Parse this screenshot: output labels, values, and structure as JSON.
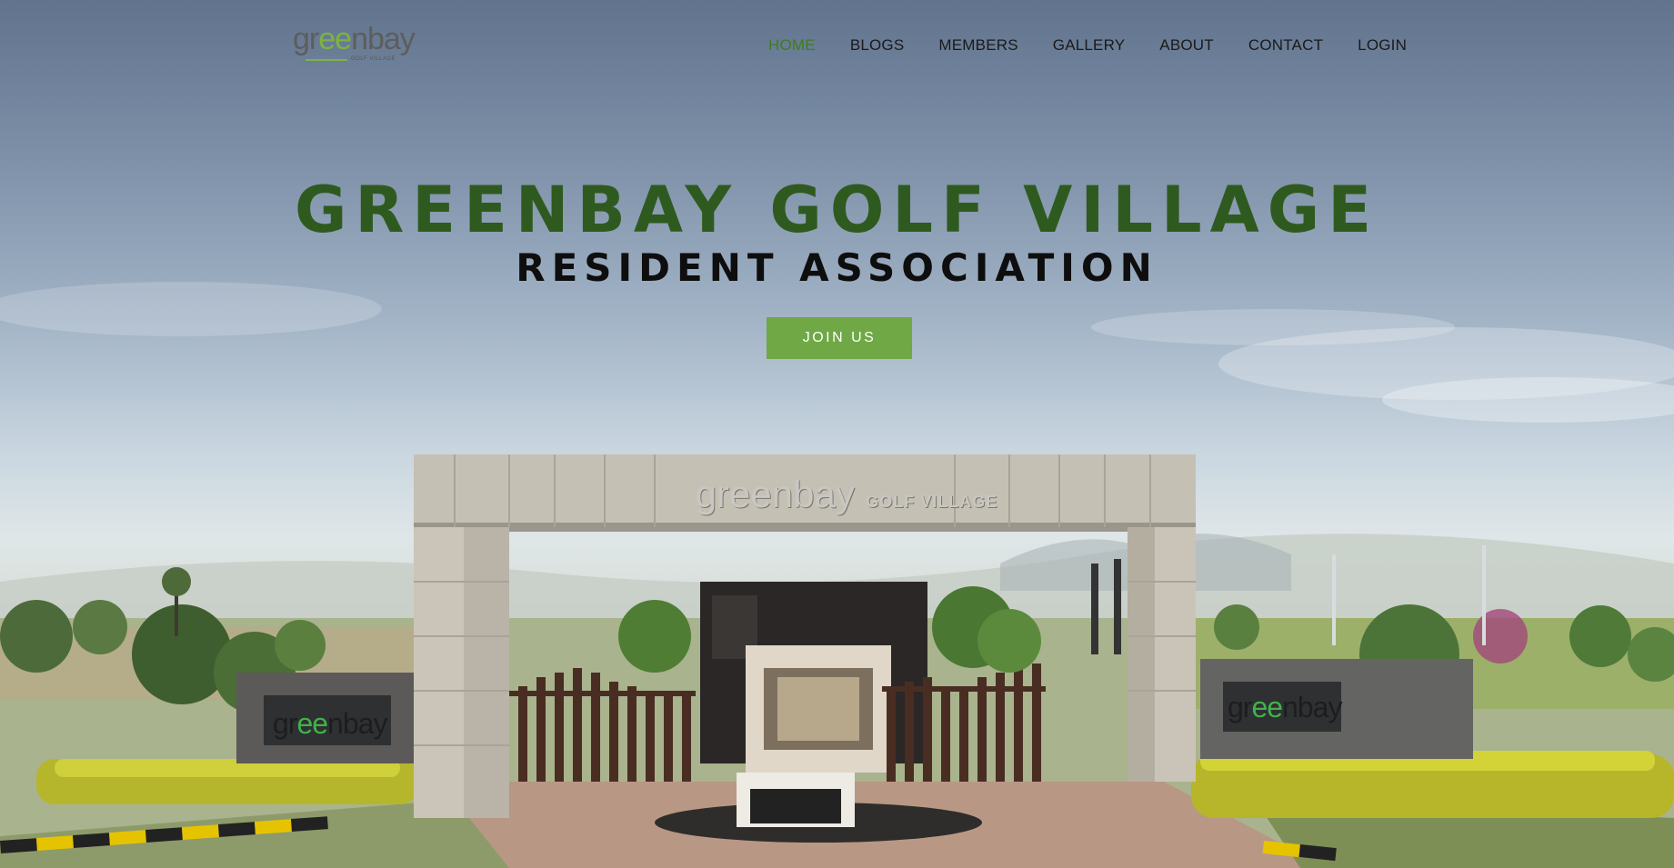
{
  "header": {
    "logo": {
      "text_main_prefix": "gr",
      "text_main_accent": "ee",
      "text_main_suffix": "nbay",
      "text_sub": "GOLF VILLAGE"
    },
    "nav": [
      {
        "label": "HOME",
        "active": true
      },
      {
        "label": "BLOGS",
        "active": false
      },
      {
        "label": "MEMBERS",
        "active": false
      },
      {
        "label": "GALLERY",
        "active": false
      },
      {
        "label": "ABOUT",
        "active": false
      },
      {
        "label": "CONTACT",
        "active": false
      },
      {
        "label": "LOGIN",
        "active": false
      }
    ]
  },
  "hero": {
    "title": "GREENBAY GOLF VILLAGE",
    "subtitle": "RESIDENT ASSOCIATION",
    "cta_label": "JOIN US",
    "gate_sign_main": "greenbay",
    "gate_sign_sub": "GOLF VILLAGE",
    "wall_logo_prefix": "gr",
    "wall_logo_accent": "ee",
    "wall_logo_suffix": "nbay"
  },
  "colors": {
    "accent_green": "#6fa845",
    "title_green": "#2f5a1f",
    "active_nav": "#3f7d1e"
  }
}
